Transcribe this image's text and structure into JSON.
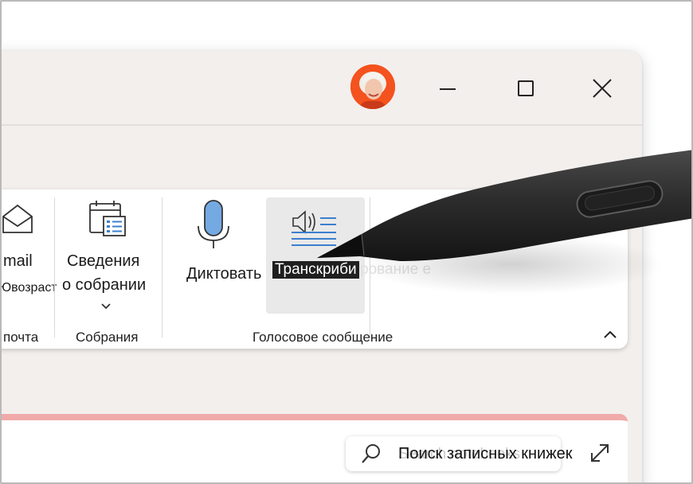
{
  "titlebar": {
    "avatar_icon": "user-avatar",
    "minimize_icon": "minimize-icon",
    "maximize_icon": "maximize-icon",
    "close_icon": "close-icon"
  },
  "ribbon": {
    "email_button": {
      "label": "mail",
      "sublabel": "Ювозраст",
      "icon": "envelope-icon"
    },
    "email_group_label": "почта",
    "meeting_details_button": {
      "label_line1": "Сведения",
      "label_line2": "о собрании",
      "icon": "calendar-list-icon"
    },
    "meetings_group_label": "Собрания",
    "dictate_button": {
      "label": "Диктовать",
      "icon": "microphone-icon"
    },
    "transcribe_button": {
      "tooltip": "Транскриби",
      "ghost_text": "рование е",
      "icon": "speaker-lines-icon"
    },
    "voice_group_label": "Голосовое сообщение",
    "collapse_icon": "chevron-up-icon"
  },
  "search": {
    "ghost_text": "Search notebooks",
    "label": "Поиск записных книжек",
    "icon": "search-icon"
  },
  "expand_icon": "expand-diagonal-icon",
  "colors": {
    "window_bg": "#f3efed",
    "mic_fill": "#74a9e2",
    "accent_lines": "#3b7fd0",
    "panel_stripe": "#f0aaaa",
    "avatar_bg": "#f4521e",
    "pen_body": "#2b2b2b"
  }
}
